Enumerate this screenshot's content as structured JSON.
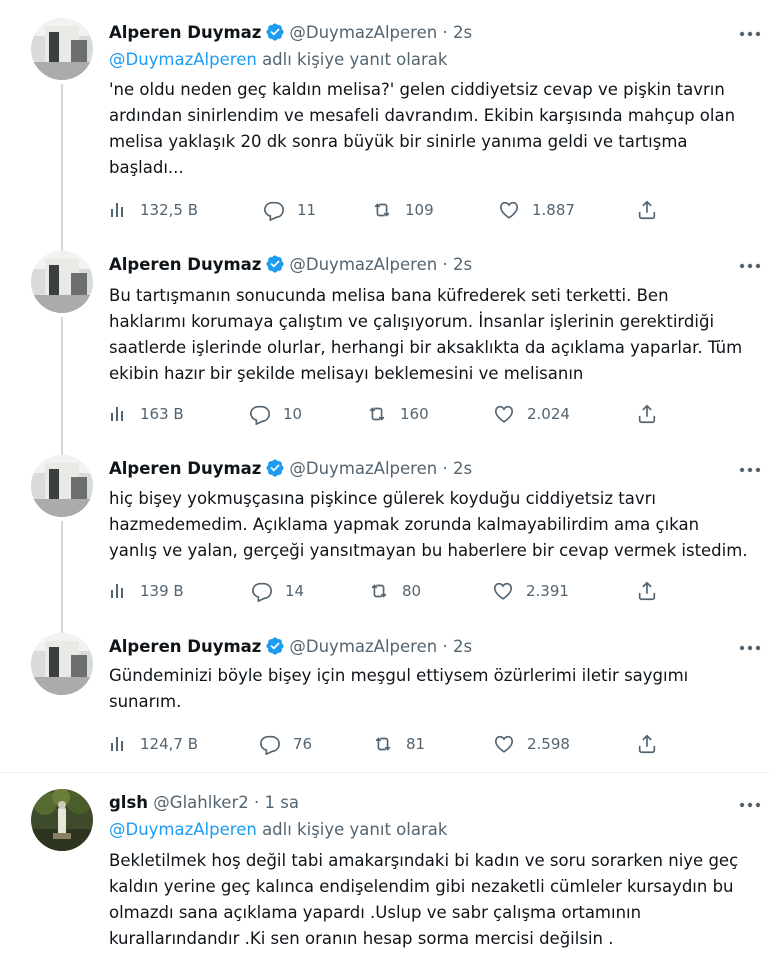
{
  "thread": [
    {
      "name": "Alperen Duymaz",
      "handle": "@DuymazAlperen",
      "time": "· 2s",
      "reply_prefix": "@DuymazAlperen",
      "reply_suffix": "adlı kişiye yanıt olarak",
      "text": "'ne oldu neden geç kaldın melisa?'  gelen ciddiyetsiz cevap ve pişkin tavrın\nardından sinirlendim ve mesafeli davrandım. Ekibin karşısında mahçup olan\nmelisa yaklaşık 20 dk sonra büyük bir sinirle yanıma geldi ve tartışma\nbaşladı...",
      "views": "132,5 B",
      "replies": "11",
      "retweets": "109",
      "likes": "1.887"
    },
    {
      "name": "Alperen Duymaz",
      "handle": "@DuymazAlperen",
      "time": "· 2s",
      "text": "Bu tartışmanın sonucunda melisa bana küfrederek seti terketti. Ben\nhaklarımı korumaya çalıştım ve çalışıyorum. İnsanlar işlerinin gerektirdiği\nsaatlerde işlerinde olurlar, herhangi bir aksaklıkta da açıklama yaparlar. Tüm\nekibin hazır bir şekilde melisayı beklemesini ve melisanın",
      "views": "163 B",
      "replies": "10",
      "retweets": "160",
      "likes": "2.024"
    },
    {
      "name": "Alperen Duymaz",
      "handle": "@DuymazAlperen",
      "time": "· 2s",
      "text": "hiç bişey yokmuşçasına pişkince gülerek koyduğu ciddiyetsiz tavrı\nhazmedemedim. Açıklama yapmak zorunda kalmayabilirdim ama çıkan\nyanlış ve yalan, gerçeği yansıtmayan bu haberlere bir cevap vermek istedim.",
      "views": "139 B",
      "replies": "14",
      "retweets": "80",
      "likes": "2.391"
    },
    {
      "name": "Alperen Duymaz",
      "handle": "@DuymazAlperen",
      "time": "· 2s",
      "text": "Gündeminizi böyle bişey için meşgul ettiysem özürlerimi iletir saygımı\nsunarım.",
      "views": "124,7 B",
      "replies": "76",
      "retweets": "81",
      "likes": "2.598"
    }
  ],
  "reply": {
    "name": "glsh",
    "handle": "@Glahlker2",
    "time": "· 1 sa",
    "reply_prefix": "@DuymazAlperen",
    "reply_suffix": "adlı kişiye yanıt olarak",
    "text": "Bekletilmek hoş değil tabi amakarşındaki bi kadın ve soru sorarken niye geç\nkaldın yerine geç kalınca endişelendim gibi nezaketli cümleler kursaydın bu\nolmazdı sana açıklama yapardı .Uslup ve sabr çalışma ortamının\nkurallarındandır .Ki sen oranın hesap sorma mercisi değilsin ."
  },
  "colors": {
    "accent": "#1d9bf0",
    "muted": "#536471",
    "text": "#0f1419",
    "line": "#cfd9de"
  },
  "icons": [
    "verified-badge-icon",
    "more-icon",
    "views-icon",
    "reply-icon",
    "retweet-icon",
    "like-icon",
    "share-icon"
  ]
}
